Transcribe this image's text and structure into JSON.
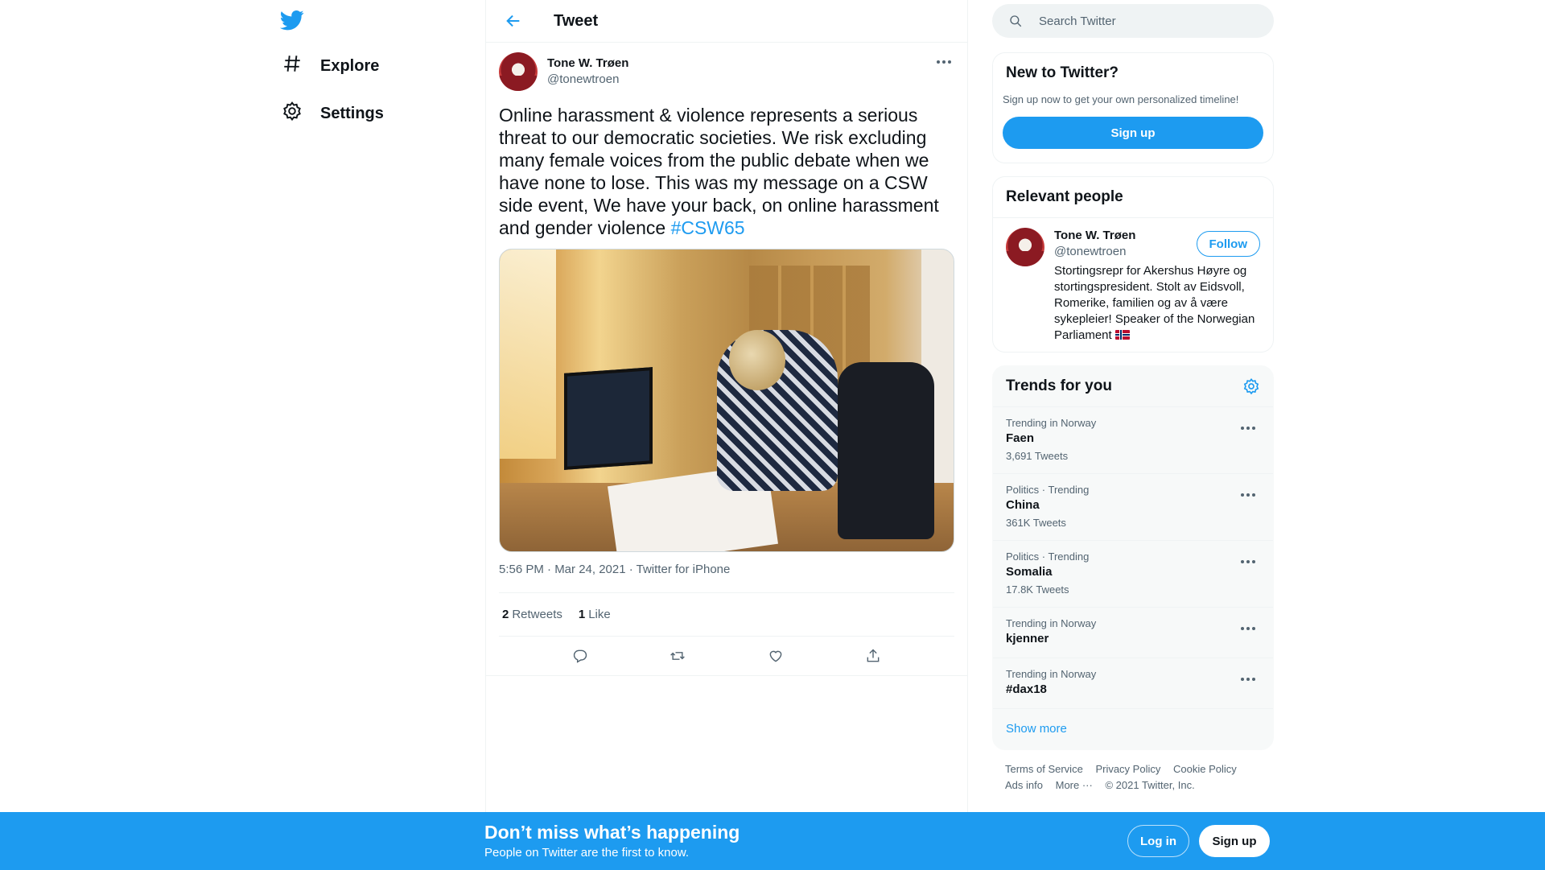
{
  "nav": {
    "logo_icon": "twitter-bird-icon",
    "items": [
      {
        "label": "Explore",
        "icon": "hashtag-icon"
      },
      {
        "label": "Settings",
        "icon": "gear-icon"
      }
    ]
  },
  "header": {
    "title": "Tweet",
    "back_icon": "arrow-left-icon"
  },
  "tweet": {
    "author_name": "Tone W. Trøen",
    "author_handle": "@tonewtroen",
    "text": "Online harassment & violence represents a serious threat to our democratic societies. We risk excluding many female voices from the public debate when we have none to lose. This was my message on a CSW side event, We have your back, on online harassment and gender violence ",
    "hashtag": "#CSW65",
    "meta": "5:56 PM · Mar 24, 2021 · Twitter for iPhone",
    "retweets_count": "2",
    "retweets_label": "Retweets",
    "likes_count": "1",
    "likes_label": "Like",
    "actions": [
      "reply-icon",
      "retweet-icon",
      "like-icon",
      "share-icon"
    ]
  },
  "search": {
    "placeholder": "Search Twitter"
  },
  "new_to_twitter": {
    "title": "New to Twitter?",
    "subtitle": "Sign up now to get your own personalized timeline!",
    "button": "Sign up"
  },
  "relevant_people": {
    "title": "Relevant people",
    "name": "Tone W. Trøen",
    "handle": "@tonewtroen",
    "follow": "Follow",
    "bio": "Stortingsrepr for Akershus Høyre og stortingspresident. Stolt av Eidsvoll, Romerike, familien og av å være sykepleier! Speaker of the Norwegian Parliament "
  },
  "trends": {
    "title": "Trends for you",
    "items": [
      {
        "meta": "Trending in Norway",
        "name": "Faen",
        "count": "3,691 Tweets"
      },
      {
        "meta": "Politics · Trending",
        "name": "China",
        "count": "361K Tweets"
      },
      {
        "meta": "Politics · Trending",
        "name": "Somalia",
        "count": "17.8K Tweets"
      },
      {
        "meta": "Trending in Norway",
        "name": "kjenner",
        "count": ""
      },
      {
        "meta": "Trending in Norway",
        "name": "#dax18",
        "count": ""
      }
    ],
    "show_more": "Show more"
  },
  "footer": {
    "links": [
      "Terms of Service",
      "Privacy Policy",
      "Cookie Policy",
      "Ads info",
      "More ···"
    ],
    "copyright": "© 2021 Twitter, Inc."
  },
  "bottom_bar": {
    "title": "Don’t miss what’s happening",
    "subtitle": "People on Twitter are the first to know.",
    "login": "Log in",
    "signup": "Sign up"
  },
  "colors": {
    "accent": "#1d9bf0",
    "text": "#0f1419",
    "secondary": "#536471"
  }
}
